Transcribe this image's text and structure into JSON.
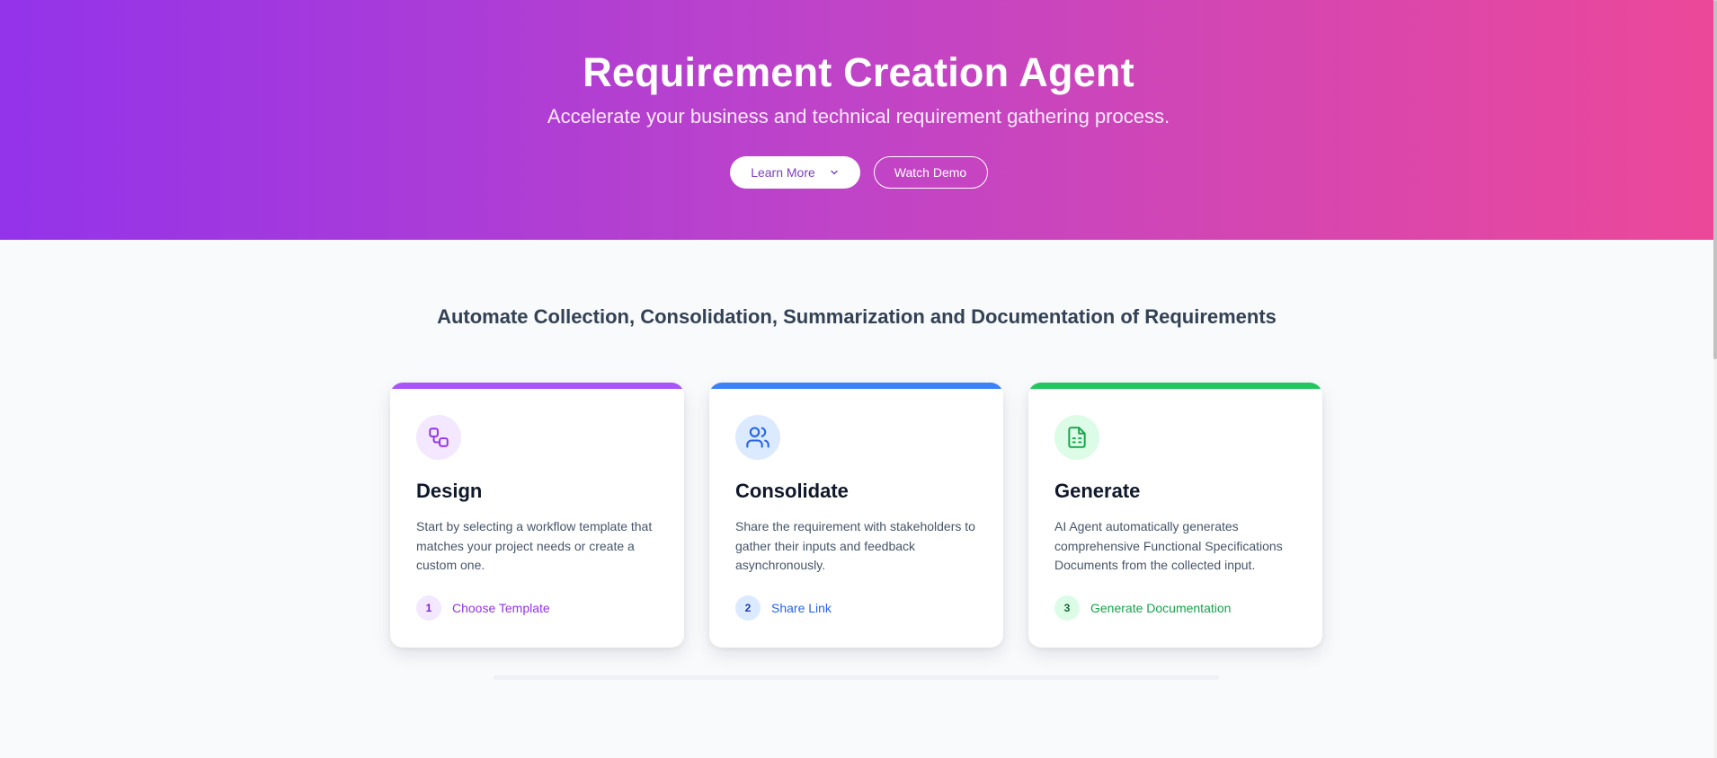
{
  "hero": {
    "title": "Requirement Creation Agent",
    "subtitle": "Accelerate your business and technical requirement gathering process.",
    "learn_more_label": "Learn More",
    "watch_demo_label": "Watch Demo"
  },
  "section": {
    "title": "Automate Collection, Consolidation, Summarization and Documentation of Requirements"
  },
  "cards": [
    {
      "title": "Design",
      "description": "Start by selecting a workflow template that matches your project needs or create a custom one.",
      "step_number": "1",
      "step_label": "Choose Template",
      "icon": "workflow-icon",
      "accent": "#a855f7",
      "icon_bg": "#f3e8ff",
      "step_color": "#9333ea"
    },
    {
      "title": "Consolidate",
      "description": "Share the requirement with stakeholders to gather their inputs and feedback asynchronously.",
      "step_number": "2",
      "step_label": "Share Link",
      "icon": "users-icon",
      "accent": "#3b82f6",
      "icon_bg": "#dbeafe",
      "step_color": "#2563eb"
    },
    {
      "title": "Generate",
      "description": "AI Agent automatically generates comprehensive Functional Specifications Documents from the collected input.",
      "step_number": "3",
      "step_label": "Generate Documentation",
      "icon": "file-spreadsheet-icon",
      "accent": "#22c55e",
      "icon_bg": "#dcfce7",
      "step_color": "#16a34a"
    }
  ],
  "colors": {
    "hero_gradient_start": "#9333ea",
    "hero_gradient_end": "#ec4899",
    "background": "#f8fafc"
  }
}
